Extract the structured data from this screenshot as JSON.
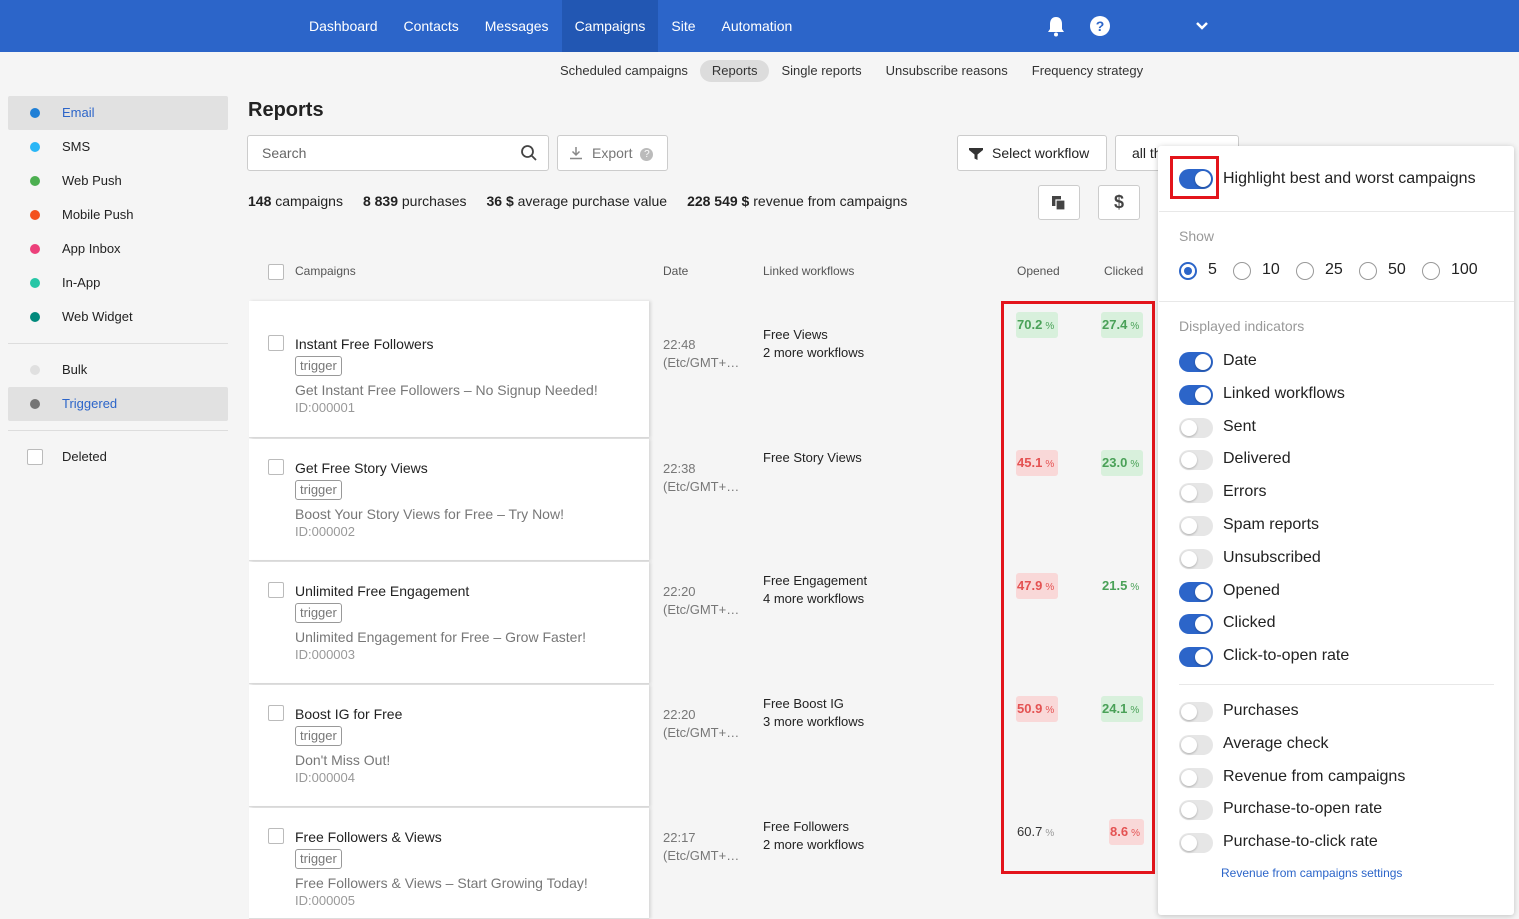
{
  "nav": {
    "items": [
      "Dashboard",
      "Contacts",
      "Messages",
      "Campaigns",
      "Site",
      "Automation"
    ],
    "active_index": 3,
    "help_label": "?"
  },
  "subnav": {
    "items": [
      "Scheduled campaigns",
      "Reports",
      "Single reports",
      "Unsubscribe reasons",
      "Frequency strategy"
    ],
    "active_index": 1
  },
  "sidebar": {
    "channels": [
      {
        "label": "Email",
        "color": "#1f7fd6",
        "active": true
      },
      {
        "label": "SMS",
        "color": "#29b6f6",
        "active": false
      },
      {
        "label": "Web Push",
        "color": "#4caf50",
        "active": false
      },
      {
        "label": "Mobile Push",
        "color": "#f4511e",
        "active": false
      },
      {
        "label": "App Inbox",
        "color": "#ec407a",
        "active": false
      },
      {
        "label": "In-App",
        "color": "#26c6a6",
        "active": false
      },
      {
        "label": "Web Widget",
        "color": "#00897b",
        "active": false
      }
    ],
    "types": [
      {
        "label": "Bulk",
        "color": "#e0e0e0",
        "active": false
      },
      {
        "label": "Triggered",
        "color": "#757575",
        "active": true
      }
    ],
    "deleted_label": "Deleted"
  },
  "main": {
    "title": "Reports",
    "search_placeholder": "Search",
    "export_label": "Export",
    "export_help": "?",
    "select_workflow_label": "Select workflow",
    "filter_label": "all th",
    "currency_button": "$",
    "stats": [
      {
        "value": "148",
        "label": "campaigns"
      },
      {
        "value": "8 839",
        "label": "purchases"
      },
      {
        "value": "36 $",
        "label": "average purchase value"
      },
      {
        "value": "228 549 $",
        "label": "revenue from campaigns"
      }
    ]
  },
  "table": {
    "columns": {
      "campaigns": "Campaigns",
      "date": "Date",
      "workflows": "Linked workflows",
      "opened": "Opened",
      "clicked": "Clicked"
    },
    "percent_unit": "%",
    "rows": [
      {
        "name": "Instant Free Followers",
        "tag": "trigger",
        "subject": "Get Instant Free Followers – No Signup Needed!",
        "id": "ID:000001",
        "time": "22:48",
        "tz": "(Etc/GMT+…",
        "workflow": "Free Views",
        "more": "2 more workflows",
        "opened": "70.2",
        "opened_status": "green",
        "clicked": "27.4",
        "clicked_status": "green"
      },
      {
        "name": "Get Free Story Views",
        "tag": "trigger",
        "subject": "Boost Your Story Views for Free – Try Now!",
        "id": "ID:000002",
        "time": "22:38",
        "tz": "(Etc/GMT+…",
        "workflow": "Free Story Views",
        "more": "",
        "opened": "45.1",
        "opened_status": "red",
        "clicked": "23.0",
        "clicked_status": "green"
      },
      {
        "name": "Unlimited Free Engagement",
        "tag": "trigger",
        "subject": "Unlimited Engagement for Free – Grow Faster!",
        "id": "ID:000003",
        "time": "22:20",
        "tz": "(Etc/GMT+…",
        "workflow": "Free Engagement",
        "more": "4 more workflows",
        "opened": "47.9",
        "opened_status": "red",
        "clicked": "21.5",
        "clicked_status": "plain-green"
      },
      {
        "name": "Boost IG for Free",
        "tag": "trigger",
        "subject": "Don't Miss Out!",
        "id": "ID:000004",
        "time": "22:20",
        "tz": "(Etc/GMT+…",
        "workflow": "Free Boost IG",
        "more": "3 more workflows",
        "opened": "50.9",
        "opened_status": "red",
        "clicked": "24.1",
        "clicked_status": "green"
      },
      {
        "name": "Free Followers & Views",
        "tag": "trigger",
        "subject": "Free Followers & Views – Start Growing Today!",
        "id": "ID:000005",
        "time": "22:17",
        "tz": "(Etc/GMT+…",
        "workflow": "Free Followers",
        "more": "2 more workflows",
        "opened": "60.7",
        "opened_status": "plain",
        "clicked": "8.6",
        "clicked_status": "red"
      }
    ]
  },
  "panel": {
    "highlight_label": "Highlight best and worst campaigns",
    "highlight_on": true,
    "show_label": "Show",
    "show_options": [
      "5",
      "10",
      "25",
      "50",
      "100"
    ],
    "show_selected": "5",
    "indicators_label": "Displayed indicators",
    "indicators": [
      {
        "label": "Date",
        "on": true
      },
      {
        "label": "Linked workflows",
        "on": true
      },
      {
        "label": "Sent",
        "on": false
      },
      {
        "label": "Delivered",
        "on": false
      },
      {
        "label": "Errors",
        "on": false
      },
      {
        "label": "Spam reports",
        "on": false
      },
      {
        "label": "Unsubscribed",
        "on": false
      },
      {
        "label": "Opened",
        "on": true
      },
      {
        "label": "Clicked",
        "on": true
      },
      {
        "label": "Click-to-open rate",
        "on": true
      }
    ],
    "revenue_indicators": [
      {
        "label": "Purchases",
        "on": false
      },
      {
        "label": "Average check",
        "on": false
      },
      {
        "label": "Revenue from campaigns",
        "on": false
      },
      {
        "label": "Purchase-to-open rate",
        "on": false
      },
      {
        "label": "Purchase-to-click rate",
        "on": false
      }
    ],
    "settings_link": "Revenue from campaigns settings"
  }
}
